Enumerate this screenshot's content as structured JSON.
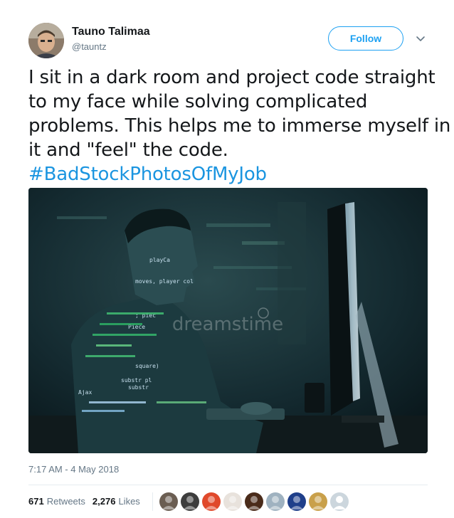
{
  "author": {
    "name": "Tauno Talimaa",
    "handle": "@tauntz",
    "avatar_icon": "user-avatar"
  },
  "header": {
    "follow_label": "Follow",
    "menu_icon": "chevron-down-icon"
  },
  "tweet": {
    "lines": [
      "I sit in a dark room and project code straight",
      "to my face while solving complicated",
      "problems. This helps me to immerse myself in",
      "it and \"feel\" the code."
    ],
    "hashtag": "#BadStockPhotosOfMyJob"
  },
  "media": {
    "watermark": "dreamstime",
    "code_overlay": [
      "playCa",
      "moves, player  col",
      "; piec",
      "Piece",
      "square)",
      "substr pl",
      "substr",
      "Ajax"
    ]
  },
  "meta": {
    "timestamp": "7:17 AM - 4 May 2018"
  },
  "stats": {
    "retweets_count": "671",
    "retweets_label": "Retweets",
    "likes_count": "2,276",
    "likes_label": "Likes"
  },
  "likers": [
    {
      "name": "liker-1",
      "color": "#6b5e52"
    },
    {
      "name": "liker-2",
      "color": "#3d3d3d"
    },
    {
      "name": "liker-3",
      "color": "#e0492b"
    },
    {
      "name": "liker-4",
      "color": "#e8e2dc"
    },
    {
      "name": "liker-5",
      "color": "#4a2b1a"
    },
    {
      "name": "liker-6",
      "color": "#9fb2c0"
    },
    {
      "name": "liker-7",
      "color": "#1f3f8a"
    },
    {
      "name": "liker-8",
      "color": "#c9a04a"
    },
    {
      "name": "liker-9",
      "color": "#ccd6dd"
    }
  ],
  "colors": {
    "accent": "#1da1f2",
    "hashtag": "#1b95e0",
    "text": "#14171a",
    "muted": "#657786"
  }
}
